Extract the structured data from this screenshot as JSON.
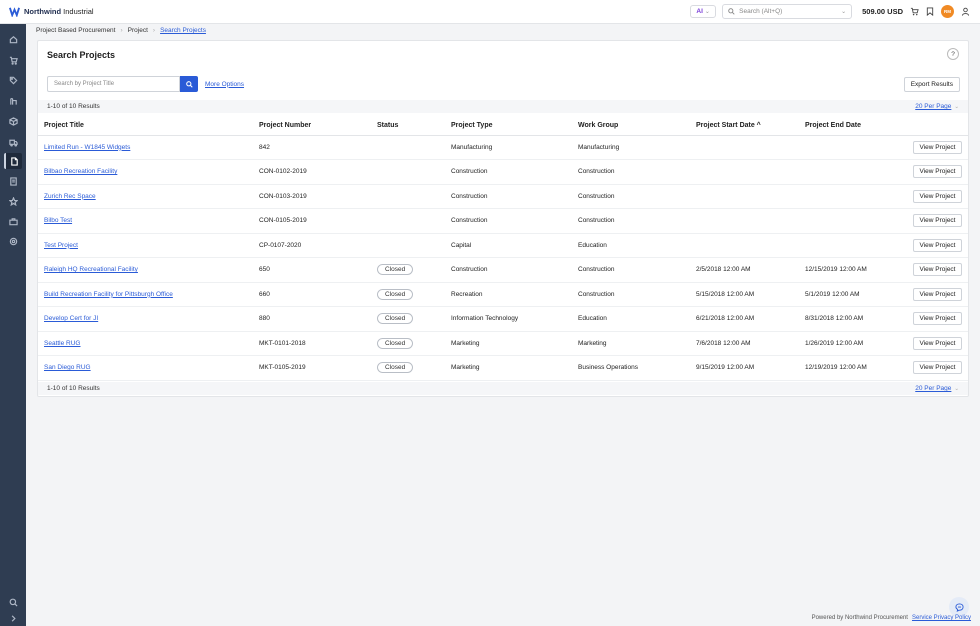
{
  "app": {
    "brand_bold": "Northwind",
    "brand_rest": " Industrial",
    "ai_label": "AI",
    "search_placeholder": "Search (Alt+Q)",
    "balance": "509.00 USD",
    "avatar_initials": "RM"
  },
  "breadcrumb": [
    "Project Based Procurement",
    "Project",
    "Search Projects"
  ],
  "page": {
    "title": "Search Projects",
    "help": "?",
    "search_placeholder": "Search by Project Title",
    "more_options": "More Options",
    "export": "Export Results",
    "results_label": "1-10 of 10 Results",
    "per_page": "20 Per Page"
  },
  "table": {
    "columns": [
      "Project Title",
      "Project Number",
      "Status",
      "Project Type",
      "Work Group",
      "Project Start Date ^",
      "Project End Date"
    ],
    "action_label": "View Project",
    "rows": [
      {
        "title": "Limited Run - W1845 Widgets",
        "number": "842",
        "status": "",
        "type": "Manufacturing",
        "group": "Manufacturing",
        "start": "",
        "end": ""
      },
      {
        "title": "Bilbao Recreation Facility",
        "number": "CON-0102-2019",
        "status": "",
        "type": "Construction",
        "group": "Construction",
        "start": "",
        "end": ""
      },
      {
        "title": "Zurich Rec Space",
        "number": "CON-0103-2019",
        "status": "",
        "type": "Construction",
        "group": "Construction",
        "start": "",
        "end": ""
      },
      {
        "title": "Bilbo Test",
        "number": "CON-0105-2019",
        "status": "",
        "type": "Construction",
        "group": "Construction",
        "start": "",
        "end": ""
      },
      {
        "title": "Test Project",
        "number": "CP-0107-2020",
        "status": "",
        "type": "Capital",
        "group": "Education",
        "start": "",
        "end": ""
      },
      {
        "title": "Raleigh HQ Recreational Facility",
        "number": "650",
        "status": "Closed",
        "type": "Construction",
        "group": "Construction",
        "start": "2/5/2018 12:00 AM",
        "end": "12/15/2019 12:00 AM"
      },
      {
        "title": "Build Recreation Facility for Pittsburgh Office",
        "number": "660",
        "status": "Closed",
        "type": "Recreation",
        "group": "Construction",
        "start": "5/15/2018 12:00 AM",
        "end": "5/1/2019 12:00 AM"
      },
      {
        "title": "Develop Cert for JI",
        "number": "880",
        "status": "Closed",
        "type": "Information Technology",
        "group": "Education",
        "start": "6/21/2018 12:00 AM",
        "end": "8/31/2018 12:00 AM"
      },
      {
        "title": "Seattle RUG",
        "number": "MKT-0101-2018",
        "status": "Closed",
        "type": "Marketing",
        "group": "Marketing",
        "start": "7/6/2018 12:00 AM",
        "end": "1/26/2019 12:00 AM"
      },
      {
        "title": "San Diego RUG",
        "number": "MKT-0105-2019",
        "status": "Closed",
        "type": "Marketing",
        "group": "Business Operations",
        "start": "9/15/2019 12:00 AM",
        "end": "12/19/2019 12:00 AM"
      }
    ]
  },
  "footer": {
    "powered_by": "Powered by Northwind Procurement",
    "privacy": "Service Privacy Policy"
  },
  "sidebar_icons": [
    "home-icon",
    "cart-icon",
    "tag-icon",
    "contracts-icon",
    "box-icon",
    "truck-icon",
    "document-icon",
    "invoice-icon",
    "star-icon",
    "briefcase-icon",
    "settings-icon",
    "search-icon",
    "expand-icon"
  ]
}
